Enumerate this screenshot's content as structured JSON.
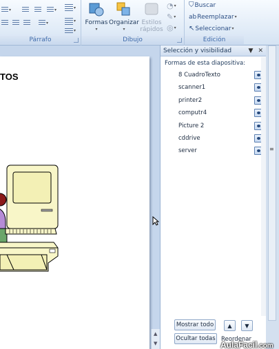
{
  "ribbon": {
    "parrafo": {
      "label": "Párrafo",
      "row1": [
        "≡",
        "⇤",
        "⇥",
        "↕"
      ],
      "row2": [
        "≡",
        "≡",
        "≡",
        "≡"
      ]
    },
    "dibujo": {
      "label": "Dibujo",
      "formas": "Formas",
      "organizar": "Organizar",
      "estilos_rapidos_line1": "Estilos",
      "estilos_rapidos_line2": "rápidos"
    },
    "edicion": {
      "label": "Edición",
      "buscar": "Buscar",
      "reemplazar": "Reemplazar",
      "seleccionar": "Seleccionar"
    }
  },
  "slide": {
    "title_fragment": "TOS"
  },
  "selection_pane": {
    "title": "Selección y visibilidad",
    "dropdown_glyph": "▼",
    "close_glyph": "✕",
    "subtitle": "Formas de esta diapositiva:",
    "shapes": [
      {
        "name": "8 CuadroTexto"
      },
      {
        "name": "scanner1"
      },
      {
        "name": "printer2"
      },
      {
        "name": "computr4"
      },
      {
        "name": "Picture 2"
      },
      {
        "name": "cddrive"
      },
      {
        "name": "server"
      }
    ],
    "show_all": "Mostrar todo",
    "hide_all": "Ocultar todas",
    "reorder": "Reordenar",
    "up_glyph": "▲",
    "down_glyph": "▼"
  },
  "watermark": {
    "brand": "AulaFacil",
    "suffix": ".com"
  },
  "colors": {
    "ribbon_bg": "#dfe9f5",
    "pane_bg": "#ffffff",
    "accent": "#1e395b"
  }
}
